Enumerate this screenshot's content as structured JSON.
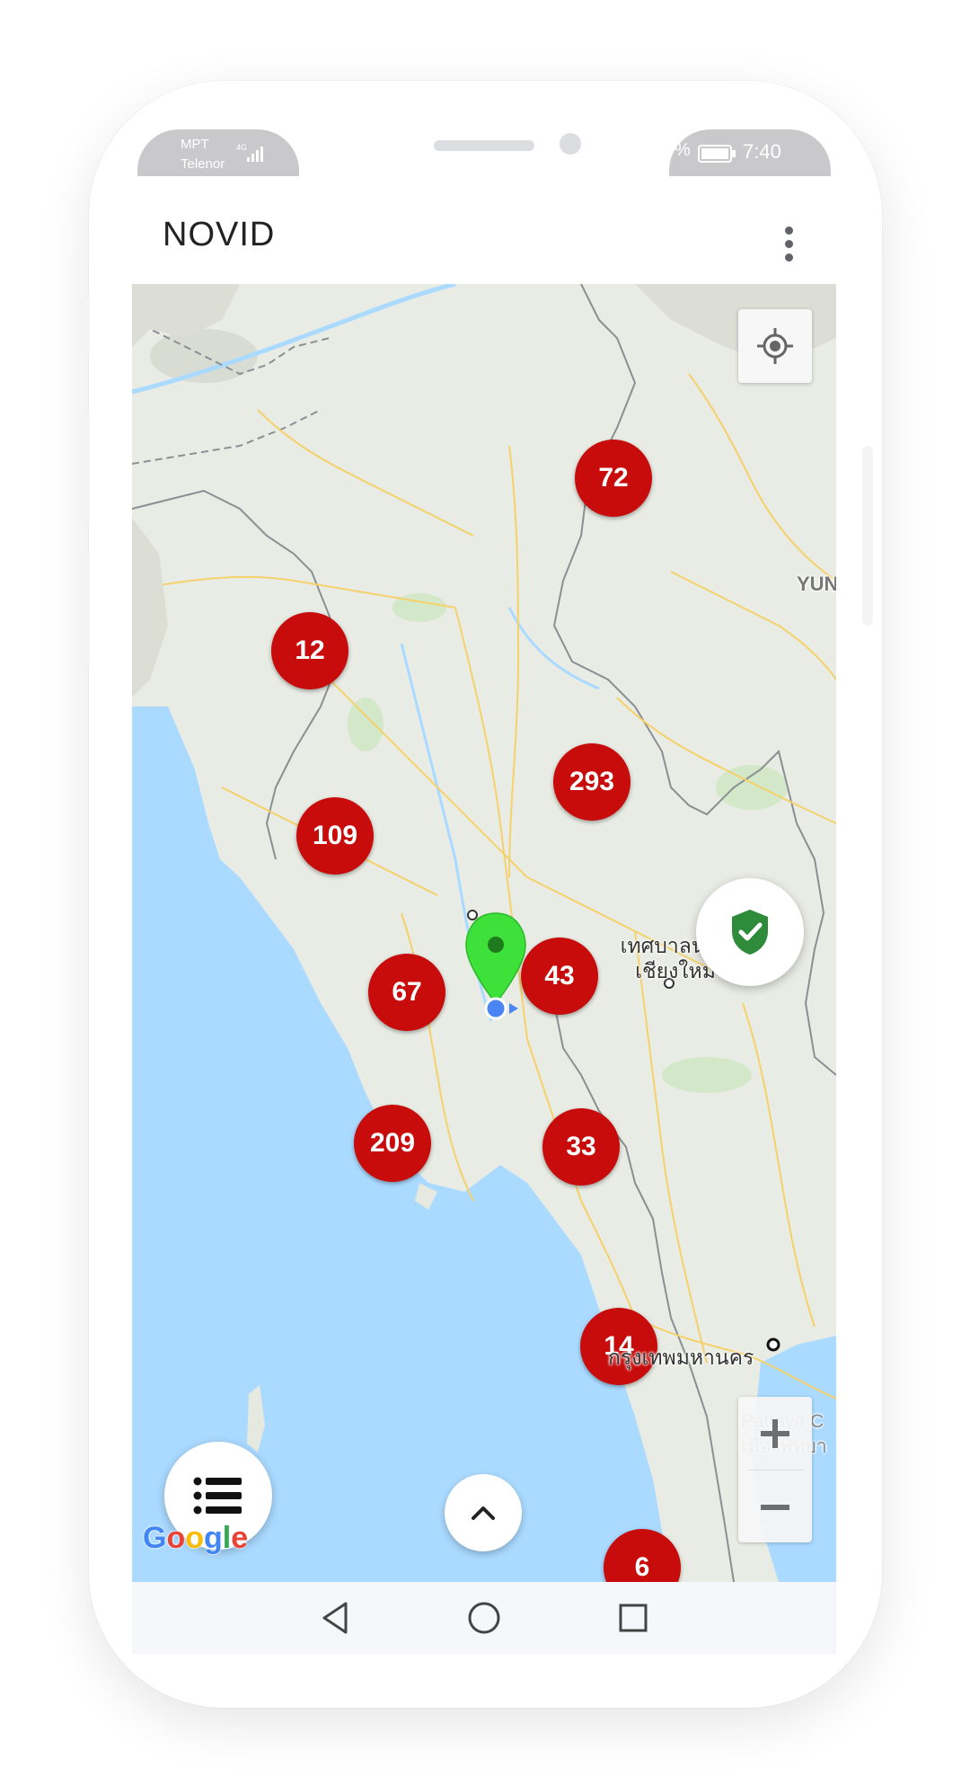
{
  "status_bar": {
    "carrier_1": "MPT",
    "carrier_2": "Telenor",
    "network": "4G",
    "battery_pct_partial": "%",
    "time": "7:40"
  },
  "app_bar": {
    "title": "NOVID",
    "overflow_icon": "more-vert-icon"
  },
  "map": {
    "region_label": "YUN",
    "city_labels": [
      {
        "text": "เทศบาลนคร\nเชียงใหม่"
      },
      {
        "text": "กรุงเทพมหานคร"
      },
      {
        "text": "Pattaya C\nเมืองพัทยา"
      }
    ],
    "clusters": [
      {
        "count": "72"
      },
      {
        "count": "12"
      },
      {
        "count": "293"
      },
      {
        "count": "109"
      },
      {
        "count": "67"
      },
      {
        "count": "43"
      },
      {
        "count": "209"
      },
      {
        "count": "33"
      },
      {
        "count": "14"
      },
      {
        "count": "6"
      }
    ],
    "attribution": "Google",
    "controls": {
      "locate_icon": "my-location-icon",
      "zoom_in": "+",
      "zoom_out": "−",
      "shield_icon": "shield-check-icon",
      "list_icon": "list-icon",
      "expand_icon": "chevron-up-icon"
    },
    "colors": {
      "cluster": "#c80b0b",
      "pin": "#3ee03a",
      "shield": "#2e8b3a",
      "water": "#aadaff",
      "land": "#e9ece4"
    }
  },
  "nav_bar": {
    "back_icon": "back-triangle-icon",
    "home_icon": "home-circle-icon",
    "recents_icon": "recents-square-icon"
  }
}
